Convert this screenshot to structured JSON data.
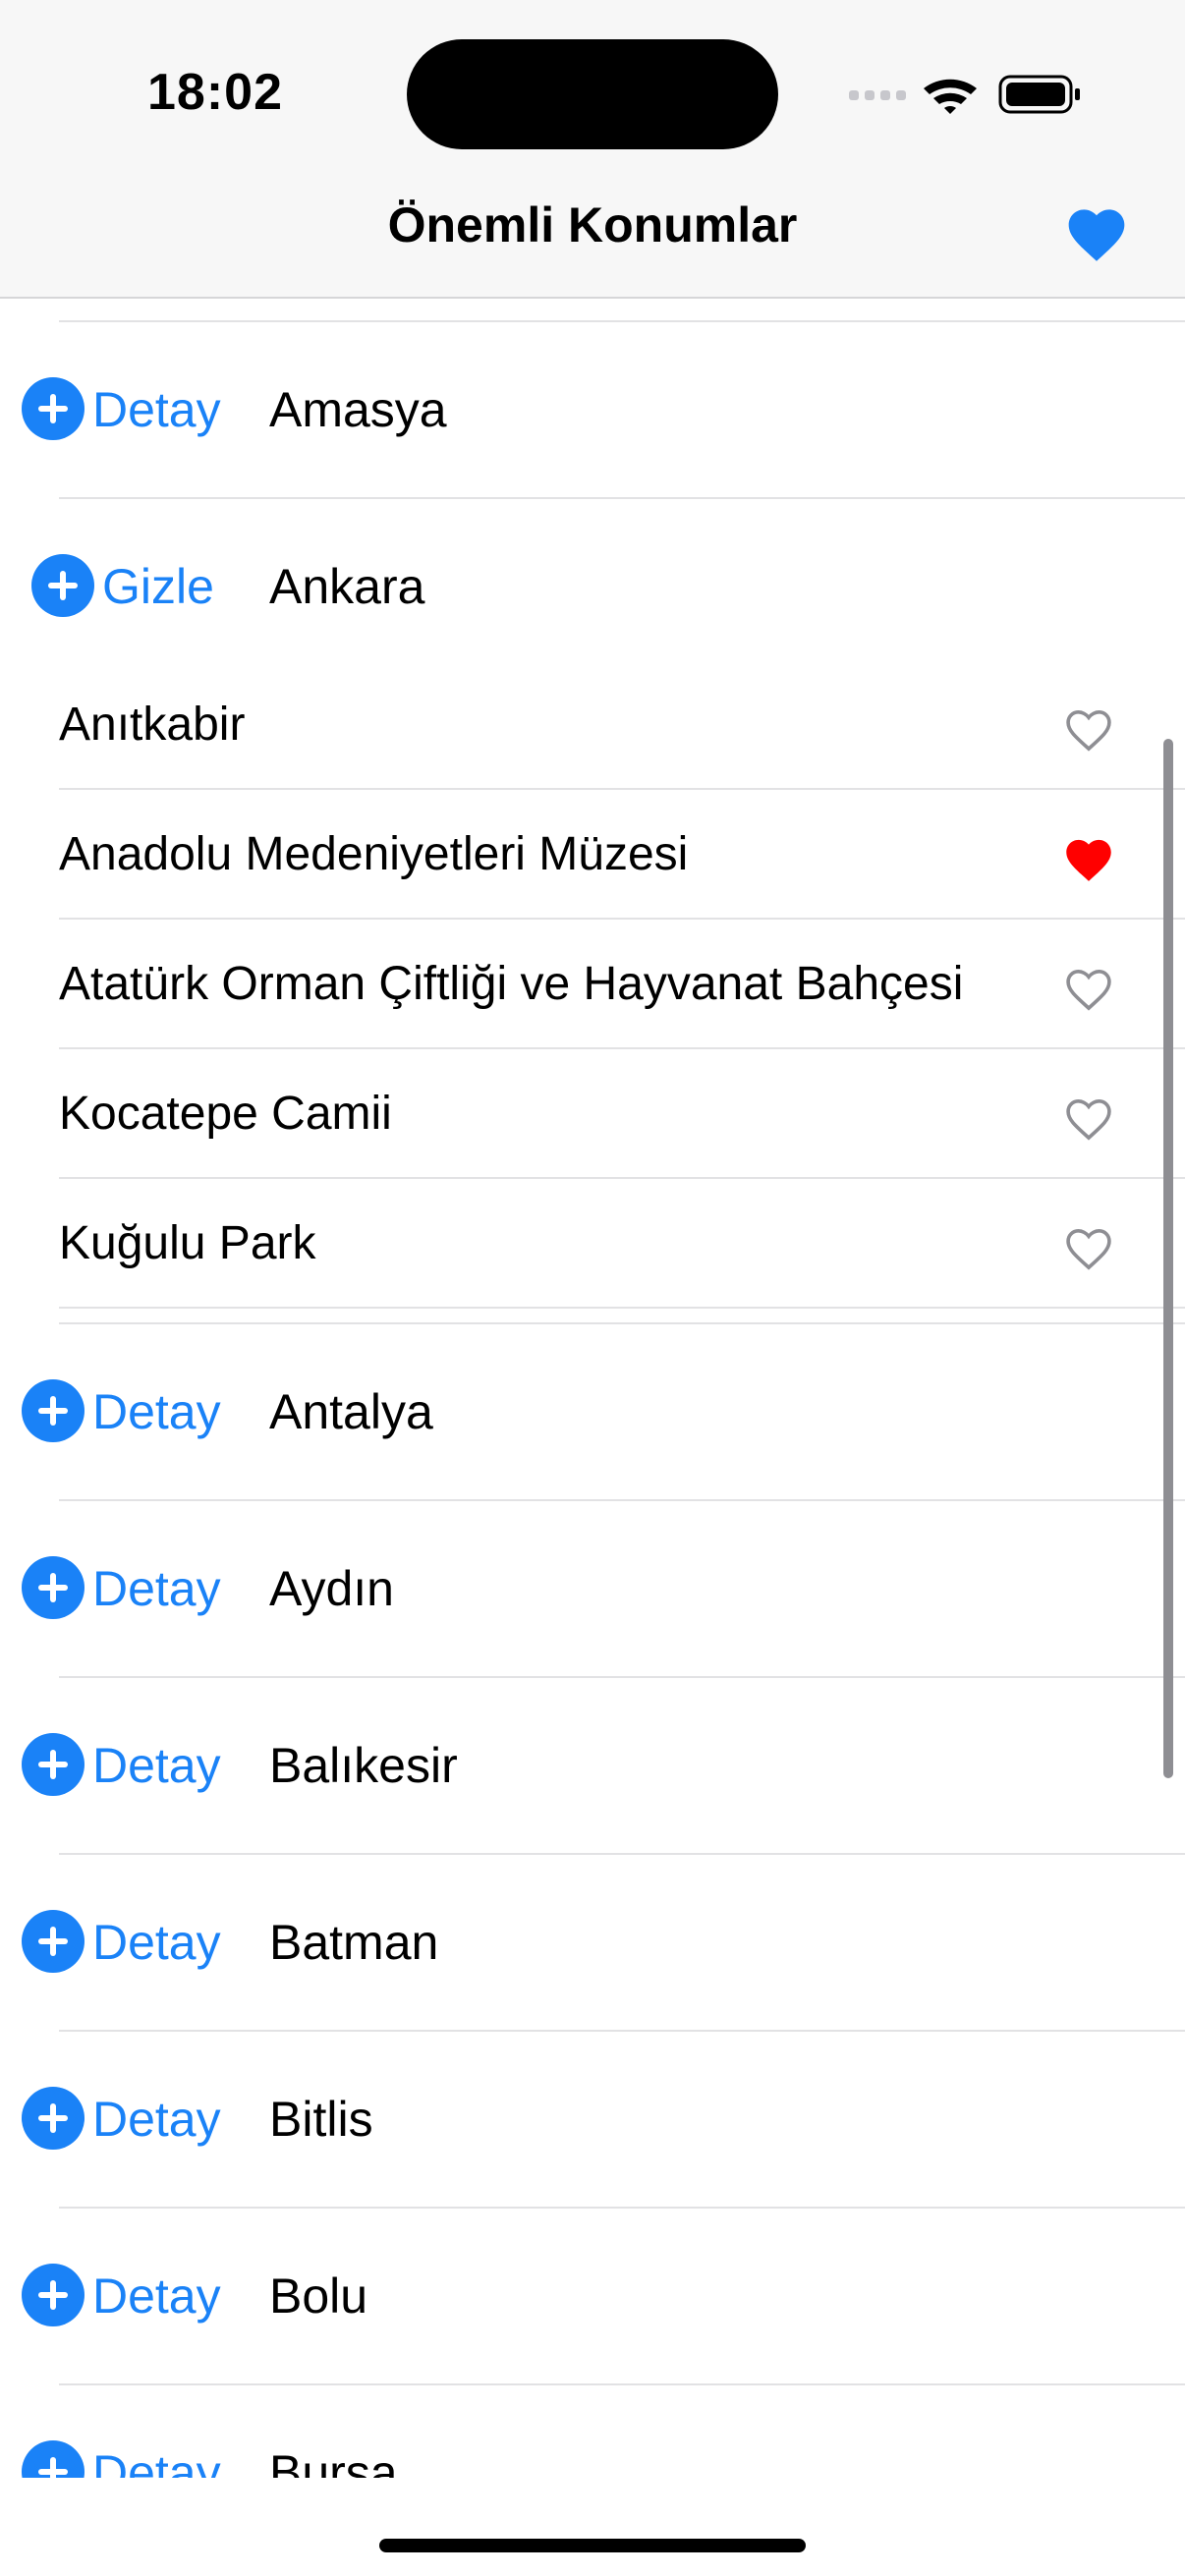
{
  "status_bar": {
    "time": "18:02"
  },
  "nav": {
    "title": "Önemli Konumlar",
    "favorites_icon": "heart-filled-icon",
    "accent": "#1a82f7"
  },
  "list": {
    "rows": [
      {
        "toggle": "Detay",
        "city": "Amasya"
      },
      {
        "toggle": "Gizle",
        "city": "Ankara",
        "places": [
          {
            "name": "Anıtkabir",
            "favorite": false
          },
          {
            "name": "Anadolu Medeniyetleri Müzesi",
            "favorite": true
          },
          {
            "name": "Atatürk Orman Çiftliği ve Hayvanat Bahçesi",
            "favorite": false
          },
          {
            "name": "Kocatepe Camii",
            "favorite": false
          },
          {
            "name": "Kuğulu Park",
            "favorite": false
          }
        ]
      },
      {
        "toggle": "Detay",
        "city": "Antalya"
      },
      {
        "toggle": "Detay",
        "city": "Aydın"
      },
      {
        "toggle": "Detay",
        "city": "Balıkesir"
      },
      {
        "toggle": "Detay",
        "city": "Batman"
      },
      {
        "toggle": "Detay",
        "city": "Bitlis"
      },
      {
        "toggle": "Detay",
        "city": "Bolu"
      },
      {
        "toggle": "Detay",
        "city": "Bursa"
      }
    ]
  },
  "colors": {
    "favorite_red": "#ff0000",
    "heart_outline": "#8e8e93"
  }
}
